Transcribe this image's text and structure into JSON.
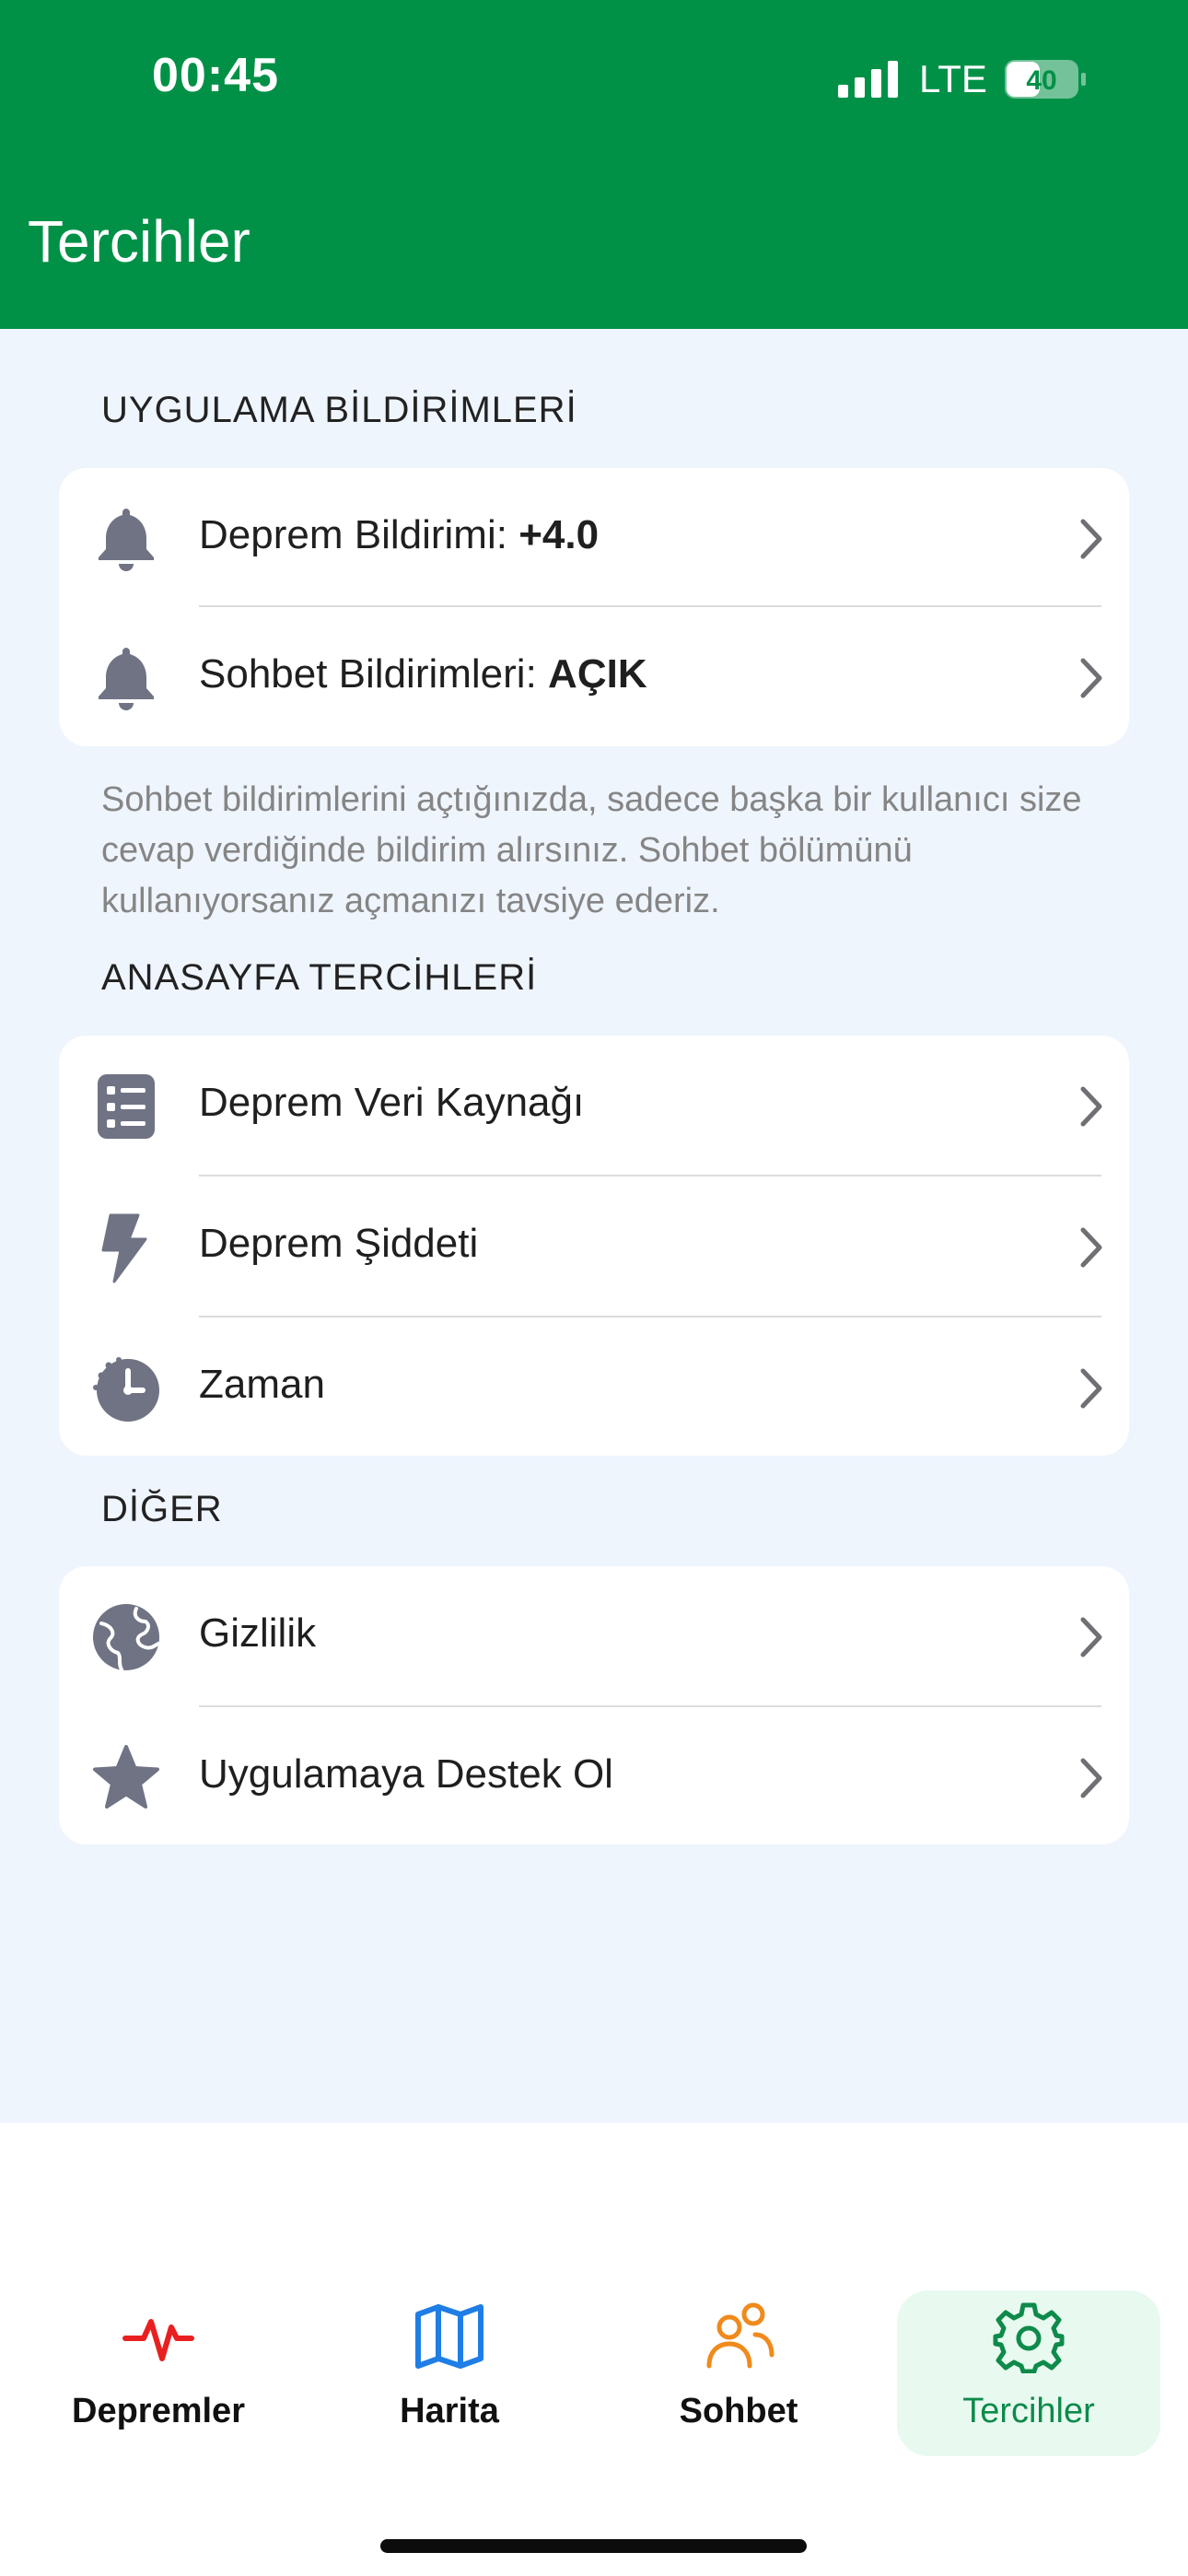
{
  "status_bar": {
    "time": "00:45",
    "network": "LTE",
    "battery": "40"
  },
  "header": {
    "title": "Tercihler"
  },
  "sections": {
    "notifications": {
      "title": "UYGULAMA BİLDİRİMLERİ",
      "rows": [
        {
          "label": "Deprem Bildirimi:",
          "value": "+4.0",
          "icon": "bell-icon"
        },
        {
          "label": "Sohbet Bildirimleri:",
          "value": "AÇIK",
          "icon": "bell-icon"
        }
      ],
      "note": "Sohbet bildirimlerini açtığınızda, sadece başka bir kullanıcı size cevap verdiğinde bildirim alırsınız. Sohbet bölümünü kullanıyorsanız açmanızı tavsiye ederiz."
    },
    "home": {
      "title": "ANASAYFA TERCİHLERİ",
      "rows": [
        {
          "label": "Deprem Veri Kaynağı",
          "icon": "list-icon"
        },
        {
          "label": "Deprem Şiddeti",
          "icon": "bolt-icon"
        },
        {
          "label": "Zaman",
          "icon": "clock-icon"
        }
      ]
    },
    "other": {
      "title": "DİĞER",
      "rows": [
        {
          "label": "Gizlilik",
          "icon": "globe-icon"
        },
        {
          "label": "Uygulamaya Destek Ol",
          "icon": "star-icon"
        }
      ]
    }
  },
  "tabbar": {
    "tabs": [
      {
        "label": "Depremler",
        "icon": "pulse-icon",
        "color": "#e8201f"
      },
      {
        "label": "Harita",
        "icon": "map-icon",
        "color": "#1f7de6"
      },
      {
        "label": "Sohbet",
        "icon": "users-icon",
        "color": "#f08a1c"
      },
      {
        "label": "Tercihler",
        "icon": "gear-icon",
        "color": "#0e8a4a",
        "active": true
      }
    ]
  },
  "colors": {
    "header_bg": "#009147",
    "content_bg": "#eff5fd",
    "icon_gray": "#6f7384",
    "active_tab_bg": "#e8faf0"
  }
}
